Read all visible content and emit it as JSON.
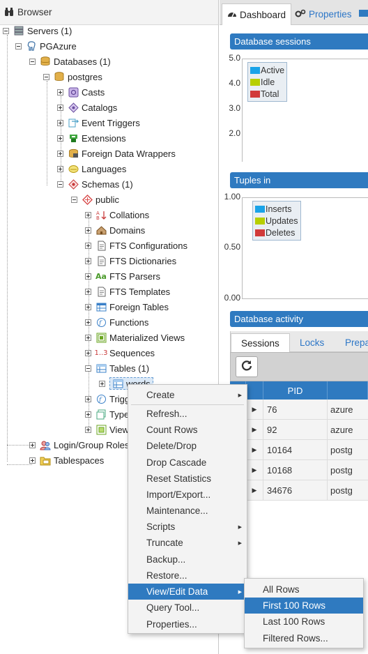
{
  "browser": {
    "title": "Browser",
    "tree": {
      "servers": "Servers (1)",
      "server": "PGAzure",
      "databases": "Databases (1)",
      "database": "postgres",
      "casts": "Casts",
      "catalogs": "Catalogs",
      "event_triggers": "Event Triggers",
      "extensions": "Extensions",
      "fdw": "Foreign Data Wrappers",
      "languages": "Languages",
      "schemas": "Schemas (1)",
      "schema": "public",
      "collations": "Collations",
      "domains": "Domains",
      "fts_configurations": "FTS Configurations",
      "fts_dictionaries": "FTS Dictionaries",
      "fts_parsers": "FTS Parsers",
      "fts_templates": "FTS Templates",
      "foreign_tables": "Foreign Tables",
      "functions": "Functions",
      "materialized_views": "Materialized Views",
      "sequences": "Sequences",
      "tables": "Tables (1)",
      "table": "words",
      "triggers": "Trigg",
      "types": "Type",
      "views": "View",
      "login_roles": "Login/Group Roles",
      "tablespaces": "Tablespaces"
    }
  },
  "tabs": {
    "dashboard": "Dashboard",
    "properties": "Properties"
  },
  "dashboard": {
    "sessions_title": "Database sessions",
    "sessions_ticks": [
      "5.0",
      "4.0",
      "3.0",
      "2.0"
    ],
    "sessions_legend": [
      "Active",
      "Idle",
      "Total"
    ],
    "tuples_title": "Tuples in",
    "tuples_ticks": [
      "1.00",
      "0.50",
      "0.00"
    ],
    "tuples_legend": [
      "Inserts",
      "Updates",
      "Deletes"
    ],
    "activity_title": "Database activity",
    "activity_tabs": [
      "Sessions",
      "Locks",
      "Prepa"
    ],
    "grid_header_pid": "PID",
    "rows": [
      {
        "pid": "76",
        "user": "azure"
      },
      {
        "pid": "92",
        "user": "azure"
      },
      {
        "pid": "10164",
        "user": "postg"
      },
      {
        "pid": "10168",
        "user": "postg"
      },
      {
        "pid": "34676",
        "user": "postg"
      }
    ]
  },
  "colors": {
    "accent": "#2f7ac0",
    "legend_blue": "#1aa3e8",
    "legend_green": "#b7cf00",
    "legend_red": "#d13a3a"
  },
  "context_menu": {
    "items": [
      "Create",
      "Refresh...",
      "Count Rows",
      "Delete/Drop",
      "Drop Cascade",
      "Reset Statistics",
      "Import/Export...",
      "Maintenance...",
      "Scripts",
      "Truncate",
      "Backup...",
      "Restore...",
      "View/Edit Data",
      "Query Tool...",
      "Properties..."
    ],
    "submenu": [
      "All Rows",
      "First 100 Rows",
      "Last 100 Rows",
      "Filtered Rows..."
    ]
  }
}
